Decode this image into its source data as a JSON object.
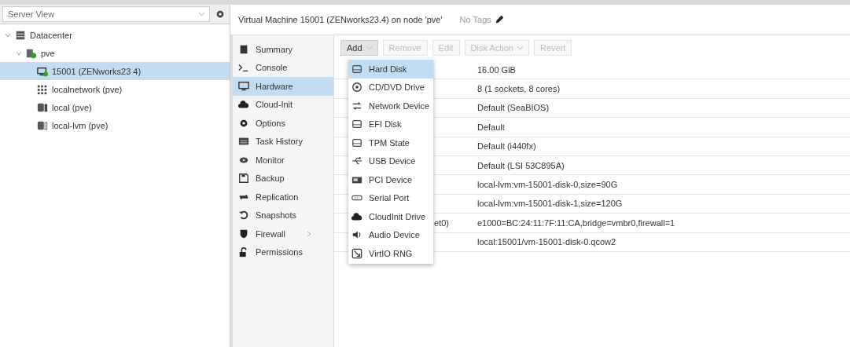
{
  "view_selector": {
    "value": "Server View"
  },
  "tree": [
    {
      "label": "Datacenter",
      "kind": "datacenter",
      "expanded": true,
      "selected": false,
      "children": [
        {
          "label": "pve",
          "kind": "node",
          "expanded": true,
          "selected": false,
          "children": [
            {
              "label": "15001 (ZENworks23 4)",
              "kind": "vm",
              "selected": true
            },
            {
              "label": "localnetwork (pve)",
              "kind": "network",
              "selected": false
            },
            {
              "label": "local (pve)",
              "kind": "storage",
              "selected": false
            },
            {
              "label": "local-lvm (pve)",
              "kind": "storage-empty",
              "selected": false
            }
          ]
        }
      ]
    }
  ],
  "header": {
    "title": "Virtual Machine 15001 (ZENworks23.4) on node 'pve'",
    "tags": "No Tags"
  },
  "nav": [
    {
      "label": "Summary",
      "kind": "book",
      "selected": false
    },
    {
      "label": "Console",
      "kind": "terminal",
      "selected": false
    },
    {
      "label": "Hardware",
      "kind": "monitor",
      "selected": true
    },
    {
      "label": "Cloud-Init",
      "kind": "cloud",
      "selected": false
    },
    {
      "label": "Options",
      "kind": "gear",
      "selected": false
    },
    {
      "label": "Task History",
      "kind": "list",
      "selected": false
    },
    {
      "label": "Monitor",
      "kind": "eye",
      "selected": false
    },
    {
      "label": "Backup",
      "kind": "floppy",
      "selected": false
    },
    {
      "label": "Replication",
      "kind": "retweet",
      "selected": false
    },
    {
      "label": "Snapshots",
      "kind": "undo",
      "selected": false
    },
    {
      "label": "Firewall",
      "kind": "shield",
      "selected": false,
      "has_submenu": true
    },
    {
      "label": "Permissions",
      "kind": "unlock",
      "selected": false
    }
  ],
  "toolbar": [
    {
      "label": "Add",
      "dropdown": true,
      "disabled": false,
      "pressed": true
    },
    {
      "label": "Remove",
      "dropdown": false,
      "disabled": true,
      "pressed": false
    },
    {
      "label": "Edit",
      "dropdown": false,
      "disabled": true,
      "pressed": false
    },
    {
      "label": "Disk Action",
      "dropdown": true,
      "disabled": true,
      "pressed": false
    },
    {
      "label": "Revert",
      "dropdown": false,
      "disabled": true,
      "pressed": false
    }
  ],
  "hardware_rows": [
    {
      "value": "16.00 GiB"
    },
    {
      "value": "8 (1 sockets, 8 cores)"
    },
    {
      "value": "Default (SeaBIOS)"
    },
    {
      "value": "Default"
    },
    {
      "value": "Default (i440fx)"
    },
    {
      "value": "Default (LSI 53C895A)"
    },
    {
      "value": "local-lvm:vm-15001-disk-0,size=90G"
    },
    {
      "value": "local-lvm:vm-15001-disk-1,size=120G"
    },
    {
      "key": "et0)",
      "value": "e1000=BC:24:11:7F:11:CA,bridge=vmbr0,firewall=1"
    },
    {
      "value": "local:15001/vm-15001-disk-0.qcow2"
    }
  ],
  "add_menu": [
    {
      "label": "Hard Disk",
      "kind": "drive",
      "selected": true
    },
    {
      "label": "CD/DVD Drive",
      "kind": "disc",
      "selected": false
    },
    {
      "label": "Network Device",
      "kind": "exchange",
      "selected": false
    },
    {
      "label": "EFI Disk",
      "kind": "drive",
      "selected": false
    },
    {
      "label": "TPM State",
      "kind": "drive",
      "selected": false
    },
    {
      "label": "USB Device",
      "kind": "usb",
      "selected": false
    },
    {
      "label": "PCI Device",
      "kind": "card",
      "selected": false
    },
    {
      "label": "Serial Port",
      "kind": "serial",
      "selected": false
    },
    {
      "label": "CloudInit Drive",
      "kind": "cloud",
      "selected": false
    },
    {
      "label": "Audio Device",
      "kind": "audio",
      "selected": false
    },
    {
      "label": "VirtIO RNG",
      "kind": "rng",
      "selected": false
    }
  ]
}
